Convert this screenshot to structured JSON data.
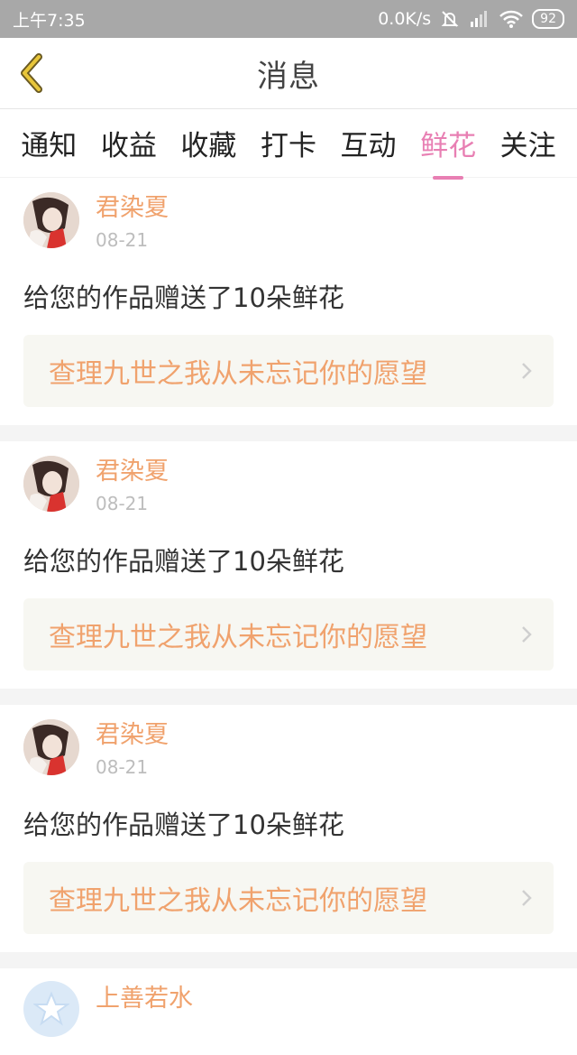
{
  "status": {
    "time": "上午7:35",
    "network_speed": "0.0K/s",
    "battery": "92"
  },
  "header": {
    "title": "消息"
  },
  "tabs": [
    {
      "label": "通知"
    },
    {
      "label": "收益"
    },
    {
      "label": "收藏"
    },
    {
      "label": "打卡"
    },
    {
      "label": "互动"
    },
    {
      "label": "鲜花",
      "active": true
    },
    {
      "label": "关注"
    }
  ],
  "messages": [
    {
      "user": "君染夏",
      "date": "08-21",
      "text": "给您的作品赠送了10朵鲜花",
      "work": "查理九世之我从未忘记你的愿望"
    },
    {
      "user": "君染夏",
      "date": "08-21",
      "text": "给您的作品赠送了10朵鲜花",
      "work": "查理九世之我从未忘记你的愿望"
    },
    {
      "user": "君染夏",
      "date": "08-21",
      "text": "给您的作品赠送了10朵鲜花",
      "work": "查理九世之我从未忘记你的愿望"
    },
    {
      "user": "上善若水"
    }
  ],
  "colors": {
    "accent_pink": "#e87fb3",
    "username_orange": "#f0a26d",
    "back_arrow": "#e8c63a"
  }
}
